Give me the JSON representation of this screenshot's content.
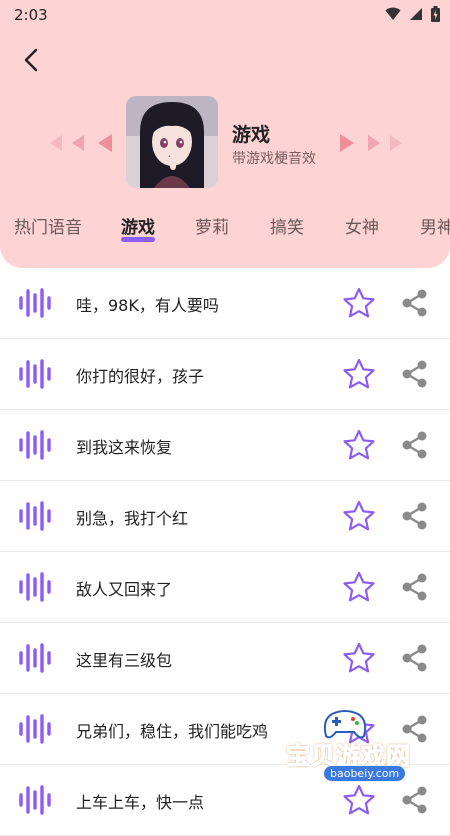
{
  "status": {
    "time": "2:03"
  },
  "category": {
    "title": "游戏",
    "subtitle": "带游戏梗音效"
  },
  "tabs": [
    {
      "label": "热门语音"
    },
    {
      "label": "游戏",
      "active": true
    },
    {
      "label": "萝莉"
    },
    {
      "label": "搞笑"
    },
    {
      "label": "女神"
    },
    {
      "label": "男神"
    }
  ],
  "items": [
    {
      "text": "哇，98K，有人要吗"
    },
    {
      "text": "你打的很好，孩子"
    },
    {
      "text": "到我这来恢复"
    },
    {
      "text": "别急，我打个红"
    },
    {
      "text": "敌人又回来了"
    },
    {
      "text": "这里有三级包"
    },
    {
      "text": "兄弟们，稳住，我们能吃鸡"
    },
    {
      "text": "上车上车，快一点"
    }
  ],
  "watermark": {
    "name": "宝贝游戏网",
    "url": "baobeiy.com"
  },
  "colors": {
    "header_bg": "#fdd3d3",
    "accent": "#8b5cf6",
    "share": "#8a8a8a"
  }
}
